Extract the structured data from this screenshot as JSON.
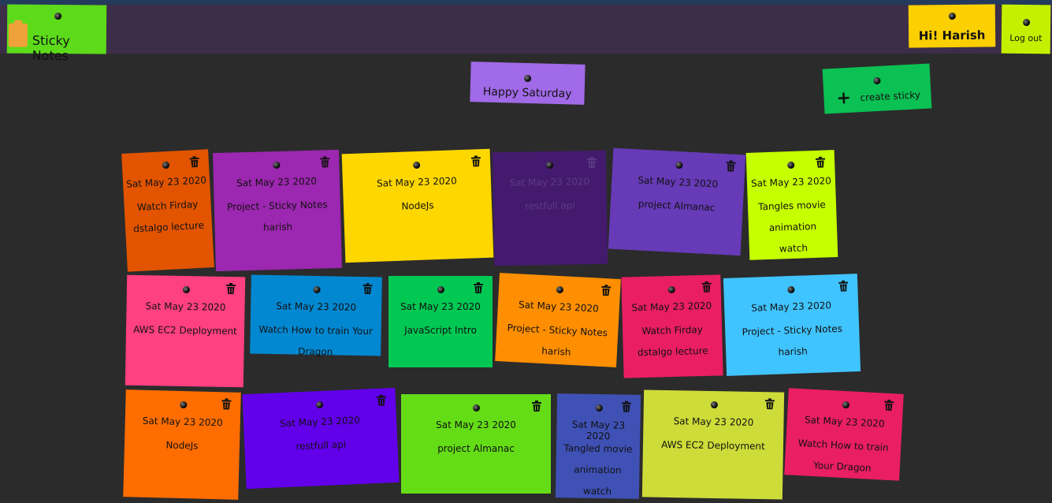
{
  "app": {
    "title": "Sticky Notes",
    "logo_icon": "clipboard-icon"
  },
  "colors": {
    "brand": "#5ddb1a",
    "greeting": "#fbcf00",
    "logout": "#c4f000",
    "day": "#a16ae8",
    "create": "#0bc153",
    "nav": "#3c2d48",
    "background": "#2b2b2b"
  },
  "header": {
    "greeting": "Hi! Harish",
    "logout_label": "Log out"
  },
  "day_banner": "Happy Saturday",
  "create_button": {
    "icon": "plus-icon",
    "label": "create sticky"
  },
  "notes": [
    {
      "date": "Sat May 23 2020",
      "text": "Watch Firday dstalgo lecture",
      "color": "#e25400"
    },
    {
      "date": "Sat May 23 2020",
      "text": "Project - Sticky Notes harish",
      "color": "#9c27b0"
    },
    {
      "date": "Sat May 23 2020",
      "text": "NodeJs",
      "color": "#fed700"
    },
    {
      "date": "Sat May 23 2020",
      "text": "restfull api",
      "color": "#441a6e",
      "text_color": "#5c3b85"
    },
    {
      "date": "Sat May 23 2020",
      "text": "project Almanac",
      "color": "#673ab7"
    },
    {
      "date": "Sat May 23 2020",
      "text": "Tangles movie animation watch",
      "color": "#c6ff00"
    },
    {
      "date": "Sat May 23 2020",
      "text": "AWS EC2 Deployment",
      "color": "#ff4081"
    },
    {
      "date": "Sat May 23 2020",
      "text": "Watch How to train Your Dragon",
      "color": "#0288d1"
    },
    {
      "date": "Sat May 23 2020",
      "text": "JavaScript Intro",
      "color": "#00c853"
    },
    {
      "date": "Sat May 23 2020",
      "text": "Project - Sticky Notes harish",
      "color": "#ff8f00"
    },
    {
      "date": "Sat May 23 2020",
      "text": "Watch Firday dstalgo lecture",
      "color": "#e91e63"
    },
    {
      "date": "Sat May 23 2020",
      "text": "Project - Sticky Notes harish",
      "color": "#40c4ff"
    },
    {
      "date": "Sat May 23 2020",
      "text": "NodeJs",
      "color": "#ff6d00"
    },
    {
      "date": "Sat May 23 2020",
      "text": "restfull api",
      "color": "#6200ea"
    },
    {
      "date": "Sat May 23 2020",
      "text": "project Almanac",
      "color": "#64dd17"
    },
    {
      "date": "Sat May 23 2020",
      "text": "Tangled movie animation watch",
      "color": "#3f51b5"
    },
    {
      "date": "Sat May 23 2020",
      "text": "AWS EC2 Deployment",
      "color": "#cddc39"
    },
    {
      "date": "Sat May 23 2020",
      "text": "Watch How to train Your Dragon",
      "color": "#e91e63"
    }
  ]
}
